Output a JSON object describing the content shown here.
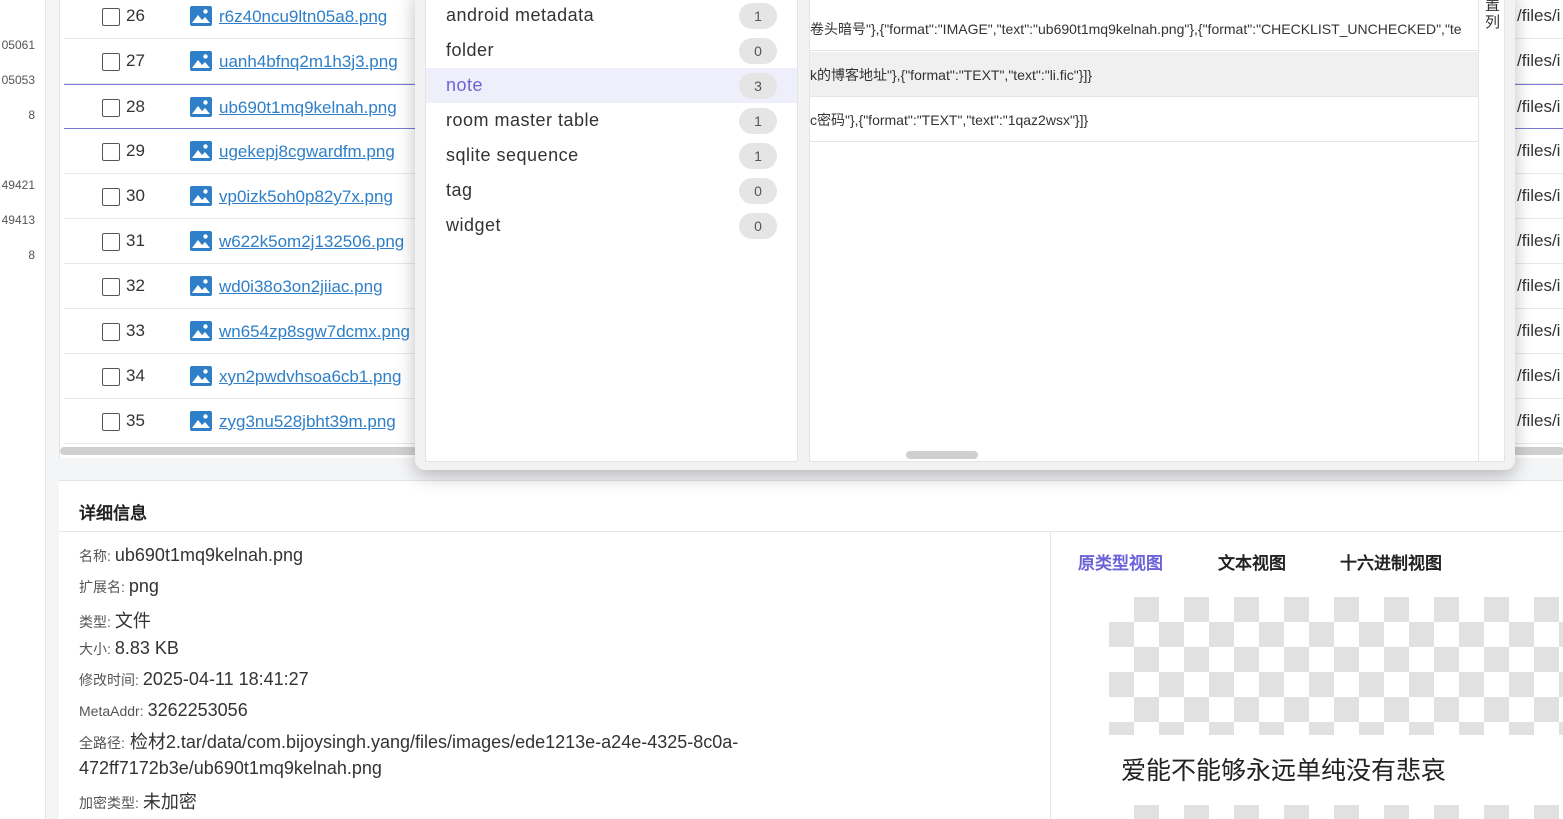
{
  "left_strip": [
    "05061",
    "05053",
    "8",
    "49421",
    "49413",
    "8"
  ],
  "files": [
    {
      "num": "26",
      "name": "r6z40ncu9ltn05a8.png",
      "path": "/files/i"
    },
    {
      "num": "27",
      "name": "uanh4bfnq2m1h3j3.png",
      "path": "/files/i"
    },
    {
      "num": "28",
      "name": "ub690t1mq9kelnah.png",
      "path": "/files/i"
    },
    {
      "num": "29",
      "name": "ugekepj8cgwardfm.png",
      "path": "/files/i"
    },
    {
      "num": "30",
      "name": "vp0izk5oh0p82y7x.png",
      "path": "/files/i"
    },
    {
      "num": "31",
      "name": "w622k5om2j132506.png",
      "path": "/files/i"
    },
    {
      "num": "32",
      "name": "wd0i38o3on2jiiac.png",
      "path": "/files/i"
    },
    {
      "num": "33",
      "name": "wn654zp8sgw7dcmx.png",
      "path": "/files/i"
    },
    {
      "num": "34",
      "name": "xyn2pwdvhsoa6cb1.png",
      "path": "/files/i"
    },
    {
      "num": "35",
      "name": "zyg3nu528jbht39m.png",
      "path": "/files/i"
    }
  ],
  "db_tables": [
    {
      "name": "android metadata",
      "count": "1"
    },
    {
      "name": "folder",
      "count": "0"
    },
    {
      "name": "note",
      "count": "3"
    },
    {
      "name": "room master table",
      "count": "1"
    },
    {
      "name": "sqlite sequence",
      "count": "1"
    },
    {
      "name": "tag",
      "count": "0"
    },
    {
      "name": "widget",
      "count": "0"
    }
  ],
  "db_rows": [
    "卷头暗号\"},{\"format\":\"IMAGE\",\"text\":\"ub690t1mq9kelnah.png\"},{\"format\":\"CHECKLIST_UNCHECKED\",\"te",
    "k的博客地址\"},{\"format\":\"TEXT\",\"text\":\"li.fic\"}]}",
    "c密码\"},{\"format\":\"TEXT\",\"text\":\"1qaz2wsx\"}]}"
  ],
  "db_column_header": "置列",
  "detail": {
    "title": "详细信息",
    "name_label": "名称:",
    "name_value": "ub690t1mq9kelnah.png",
    "ext_label": "扩展名:",
    "ext_value": "png",
    "type_label": "类型:",
    "type_value": "文件",
    "size_label": "大小:",
    "size_value": "8.83 KB",
    "mtime_label": "修改时间:",
    "mtime_value": "2025-04-11 18:41:27",
    "meta_label": "MetaAddr:",
    "meta_value": "3262253056",
    "path_label": "全路径:",
    "path_value": "检材2.tar/data/com.bijoysingh.yang/files/images/ede1213e-a24e-4325-8c0a-472ff7172b3e/ub690t1mq9kelnah.png",
    "enc_label": "加密类型:",
    "enc_value": "未加密"
  },
  "view_tabs": [
    "原类型视图",
    "文本视图",
    "十六进制视图"
  ],
  "preview_text": "爱能不能够永远单纯没有悲哀",
  "colors": {
    "accent": "#6c63d9",
    "link": "#2e7fc8"
  }
}
